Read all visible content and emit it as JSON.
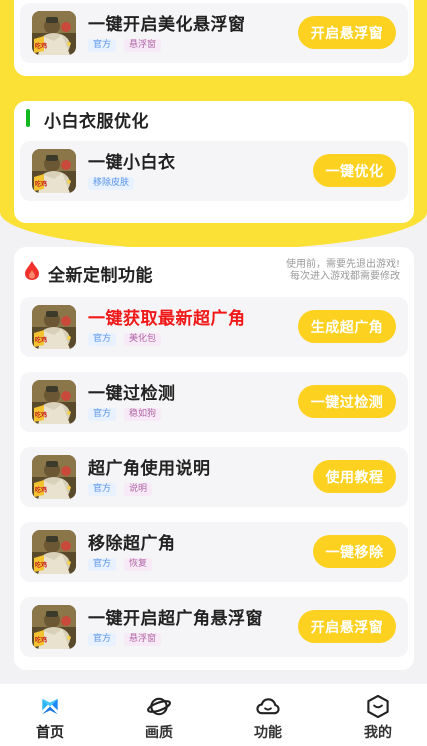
{
  "top_card": {
    "row": {
      "title": "一键开启美化悬浮窗",
      "tags": [
        "官方",
        "悬浮窗"
      ],
      "button": "开启悬浮窗"
    }
  },
  "white_section": {
    "title": "小白衣服优化",
    "row": {
      "title": "一键小白衣",
      "tags": [
        "移除皮肤"
      ],
      "button": "一键优化"
    }
  },
  "feature_section": {
    "title": "全新定制功能",
    "notice_line1": "使用前，需要先退出游戏!",
    "notice_line2": "每次进入游戏都需要修改",
    "rows": [
      {
        "title": "一键获取最新超广角",
        "tags": [
          "官方",
          "美化包"
        ],
        "button": "生成超广角"
      },
      {
        "title": "一键过检测",
        "tags": [
          "官方",
          "稳如狗"
        ],
        "button": "一键过检测"
      },
      {
        "title": "超广角使用说明",
        "tags": [
          "官方",
          "说明"
        ],
        "button": "使用教程"
      },
      {
        "title": "移除超广角",
        "tags": [
          "官方",
          "恢复"
        ],
        "button": "一键移除"
      },
      {
        "title": "一键开启超广角悬浮窗",
        "tags": [
          "官方",
          "悬浮窗"
        ],
        "button": "开启悬浮窗"
      }
    ]
  },
  "tabbar": {
    "tabs": [
      {
        "label": "首页",
        "icon": "home-icon",
        "active": true
      },
      {
        "label": "画质",
        "icon": "planet-icon",
        "active": false
      },
      {
        "label": "功能",
        "icon": "cloud-icon",
        "active": false
      },
      {
        "label": "我的",
        "icon": "user-cube-icon",
        "active": false
      }
    ]
  },
  "colors": {
    "accent_yellow": "#fbe035",
    "button_yellow": "#fdd120",
    "highlight_red": "#f01818",
    "section_green": "#12b81e",
    "tab_active_blue": "#1e88f5"
  }
}
